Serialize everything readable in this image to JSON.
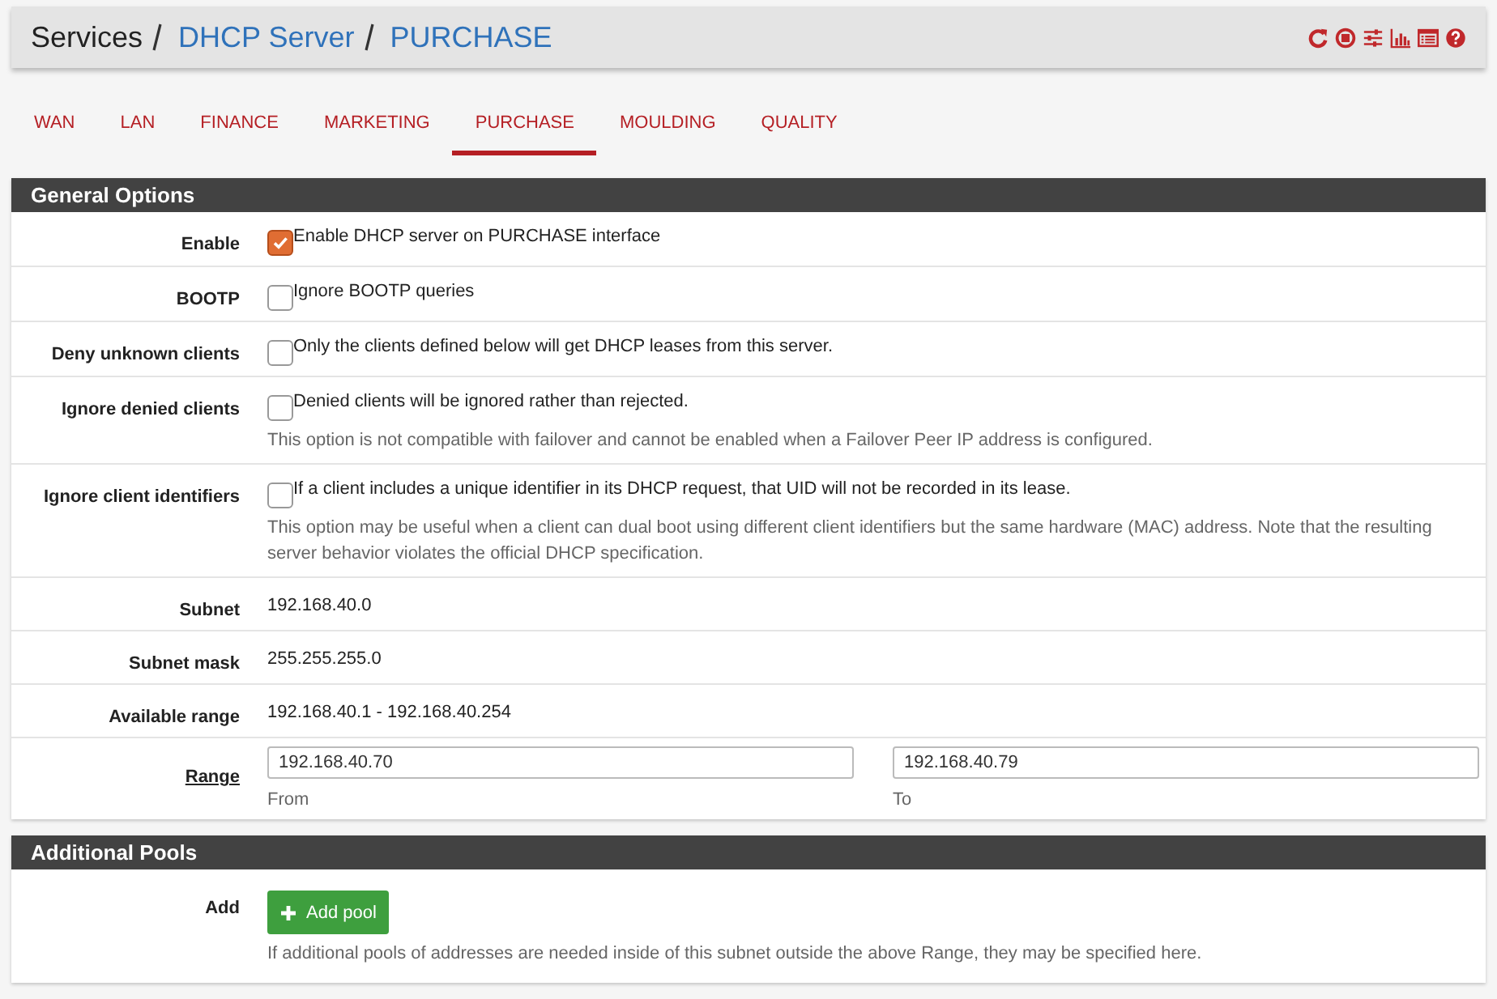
{
  "breadcrumb": [
    {
      "label": "Services",
      "link": false
    },
    {
      "label": "DHCP Server",
      "link": true
    },
    {
      "label": "PURCHASE",
      "link": true
    }
  ],
  "header_icons": [
    {
      "kind": "reload"
    },
    {
      "kind": "stop"
    },
    {
      "kind": "sliders"
    },
    {
      "kind": "chart"
    },
    {
      "kind": "list"
    },
    {
      "kind": "help"
    }
  ],
  "tabs": [
    {
      "label": "WAN",
      "selected": false
    },
    {
      "label": "LAN",
      "selected": false
    },
    {
      "label": "FINANCE",
      "selected": false
    },
    {
      "label": "MARKETING",
      "selected": false
    },
    {
      "label": "PURCHASE",
      "selected": true
    },
    {
      "label": "MOULDING",
      "selected": false
    },
    {
      "label": "QUALITY",
      "selected": false
    }
  ],
  "sections": [
    {
      "title": "General Options",
      "rows": [
        {
          "kind": "checkbox",
          "label": "Enable",
          "checked": true,
          "text": "Enable DHCP server on PURCHASE interface"
        },
        {
          "kind": "checkbox",
          "label": "BOOTP",
          "checked": false,
          "text": "Ignore BOOTP queries"
        },
        {
          "kind": "checkbox",
          "label": "Deny unknown clients",
          "checked": false,
          "text": "Only the clients defined below will get DHCP leases from this server."
        },
        {
          "kind": "checkbox",
          "label": "Ignore denied clients",
          "checked": false,
          "text": "Denied clients will be ignored rather than rejected.",
          "help": "This option is not compatible with failover and cannot be enabled when a Failover Peer IP address is configured."
        },
        {
          "kind": "checkbox",
          "label": "Ignore client identifiers",
          "checked": false,
          "text": "If a client includes a unique identifier in its DHCP request, that UID will not be recorded in its lease.",
          "help": "This option may be useful when a client can dual boot using different client identifiers but the same hardware (MAC) address. Note that the resulting server behavior violates the official DHCP specification."
        },
        {
          "kind": "text",
          "label": "Subnet",
          "text": "192.168.40.0"
        },
        {
          "kind": "text",
          "label": "Subnet mask",
          "text": "255.255.255.0"
        },
        {
          "kind": "text",
          "label": "Available range",
          "text": "192.168.40.1 - 192.168.40.254"
        },
        {
          "kind": "range",
          "label": "Range",
          "from": {
            "value": "192.168.40.70",
            "caption": "From"
          },
          "to": {
            "value": "192.168.40.79",
            "caption": "To"
          }
        }
      ]
    },
    {
      "title": "Additional Pools",
      "rows": [
        {
          "kind": "button",
          "label": "Add",
          "button": "Add pool",
          "help": "If additional pools of addresses are needed inside of this subnet outside the above Range, they may be specified here."
        }
      ]
    }
  ]
}
